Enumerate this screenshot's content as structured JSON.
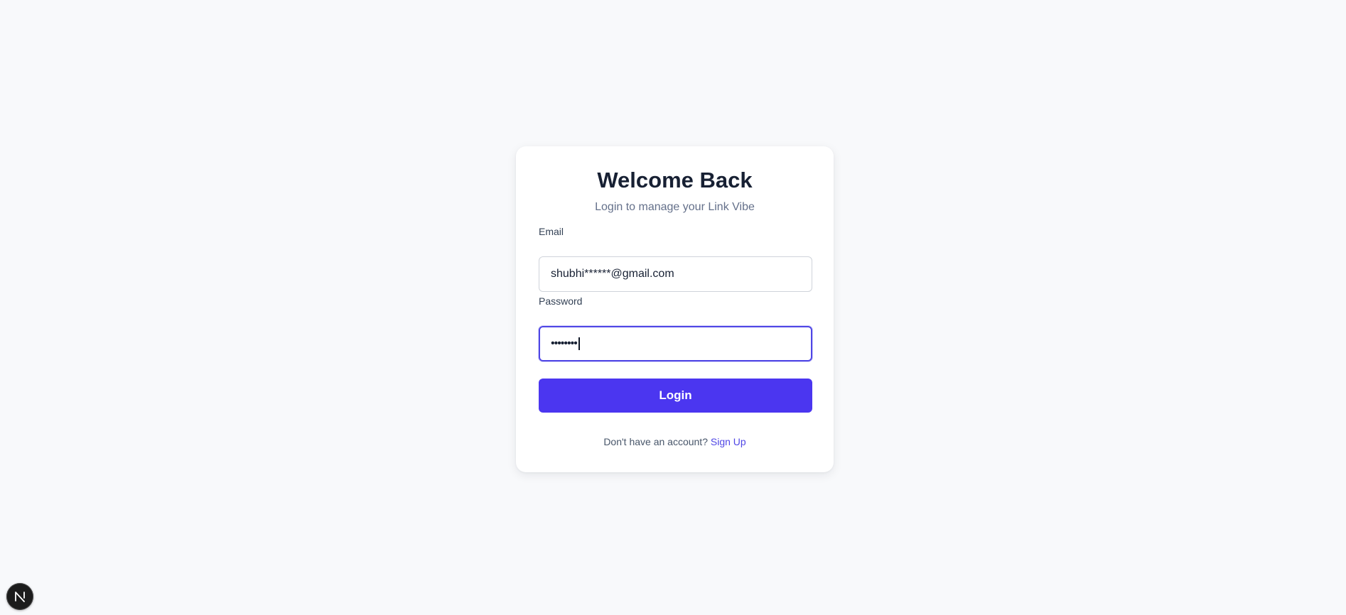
{
  "login_card": {
    "title": "Welcome Back",
    "subtitle": "Login to manage your Link Vibe",
    "email": {
      "label": "Email",
      "value": "shubhi******@gmail.com"
    },
    "password": {
      "label": "Password",
      "masked_value": "••••••••"
    },
    "login_button_label": "Login",
    "footer": {
      "prompt": "Don't have an account?",
      "link_label": "Sign Up"
    }
  },
  "dev_badge": {
    "icon": "nextjs-logo-icon",
    "letter": "N"
  },
  "colors": {
    "page_background": "#f8f9fb",
    "accent": "#4b36f0",
    "link": "#4f46e5",
    "heading": "#172033"
  }
}
